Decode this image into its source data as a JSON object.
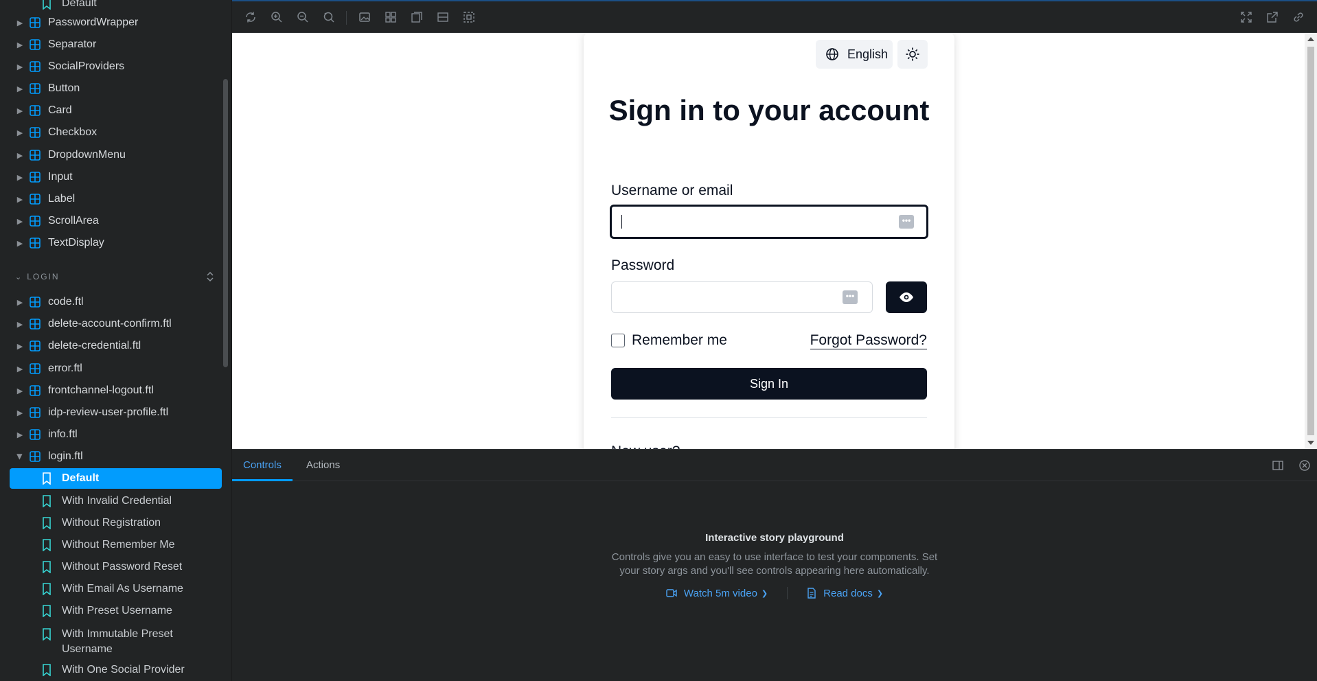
{
  "sidebar": {
    "partial_top_story": "Default",
    "components": [
      {
        "label": "PasswordWrapper"
      },
      {
        "label": "Separator"
      },
      {
        "label": "SocialProviders"
      },
      {
        "label": "Button"
      },
      {
        "label": "Card"
      },
      {
        "label": "Checkbox"
      },
      {
        "label": "DropdownMenu"
      },
      {
        "label": "Input"
      },
      {
        "label": "Label"
      },
      {
        "label": "ScrollArea"
      },
      {
        "label": "TextDisplay"
      }
    ],
    "section_label": "LOGIN",
    "login_items": [
      {
        "label": "code.ftl"
      },
      {
        "label": "delete-account-confirm.ftl"
      },
      {
        "label": "delete-credential.ftl"
      },
      {
        "label": "error.ftl"
      },
      {
        "label": "frontchannel-logout.ftl"
      },
      {
        "label": "idp-review-user-profile.ftl"
      },
      {
        "label": "info.ftl"
      },
      {
        "label": "login.ftl"
      }
    ],
    "stories": [
      {
        "label": "Default",
        "active": true
      },
      {
        "label": "With Invalid Credential"
      },
      {
        "label": "Without Registration"
      },
      {
        "label": "Without Remember Me"
      },
      {
        "label": "Without Password Reset"
      },
      {
        "label": "With Email As Username"
      },
      {
        "label": "With Preset Username"
      },
      {
        "label": "With Immutable Preset Username"
      },
      {
        "label": "With One Social Provider"
      }
    ]
  },
  "toolbar": {
    "icons": [
      "reload-icon",
      "zoom-in-icon",
      "zoom-out-icon",
      "zoom-reset-icon",
      "background-icon",
      "grid-icon",
      "viewport-icon",
      "measure-icon",
      "outline-icon",
      "fullscreen-icon",
      "open-new-tab-icon",
      "copy-link-icon"
    ]
  },
  "preview": {
    "language": "English",
    "title": "Sign in to your account",
    "username_label": "Username or email",
    "password_label": "Password",
    "remember_me": "Remember me",
    "forgot_password": "Forgot Password?",
    "sign_in": "Sign In",
    "partial_text": "New user?"
  },
  "addons": {
    "tabs": [
      {
        "label": "Controls",
        "active": true
      },
      {
        "label": "Actions"
      }
    ],
    "empty_title": "Interactive story playground",
    "empty_line1": "Controls give you an easy to use interface to test your components. Set",
    "empty_line2": "your story args and you'll see controls appearing here automatically.",
    "link_video": "Watch 5m video",
    "link_docs": "Read docs"
  },
  "colors": {
    "accent": "#029cfd",
    "link": "#4aa3f5",
    "sidebar_bg": "#222425",
    "form_dark": "#0b1220"
  }
}
